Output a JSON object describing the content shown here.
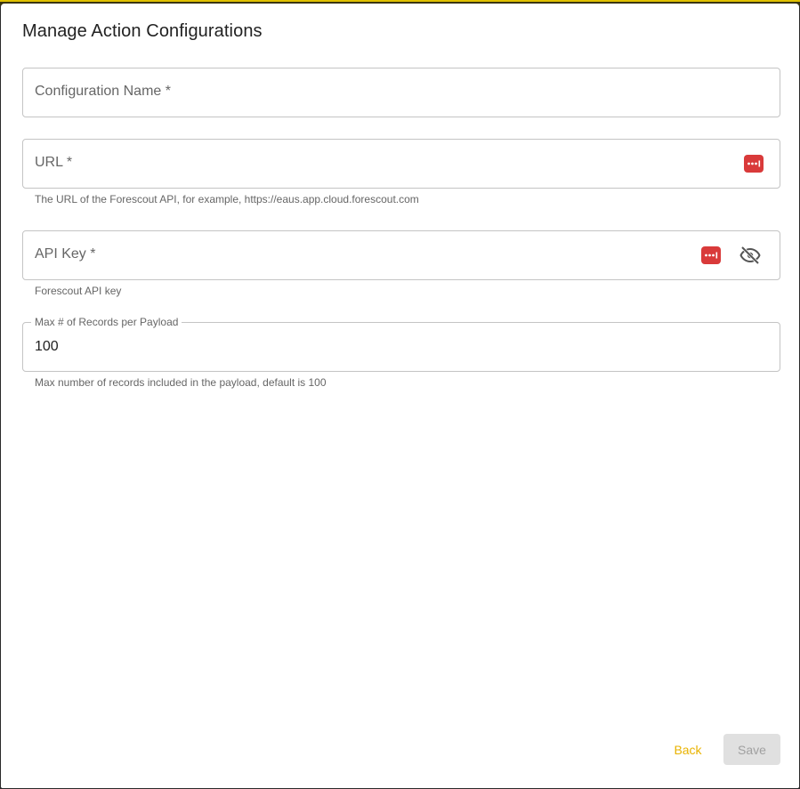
{
  "dialog": {
    "title": "Manage Action Configurations"
  },
  "fields": {
    "config_name": {
      "label": "Configuration Name *"
    },
    "url": {
      "label": "URL *",
      "helper": "The URL of the Forescout API, for example, https://eaus.app.cloud.forescout.com"
    },
    "api_key": {
      "label": "API Key *",
      "helper": "Forescout API key"
    },
    "max_records": {
      "label": "Max # of Records per Payload",
      "value": "100",
      "helper": "Max number of records included in the payload, default is 100"
    }
  },
  "actions": {
    "back_label": "Back",
    "save_label": "Save"
  },
  "colors": {
    "accent": "#e9b300",
    "password_manager_icon": "#d93a3a"
  },
  "icons": {
    "password_manager": "password-manager-icon",
    "visibility_off": "eye-off-icon"
  }
}
